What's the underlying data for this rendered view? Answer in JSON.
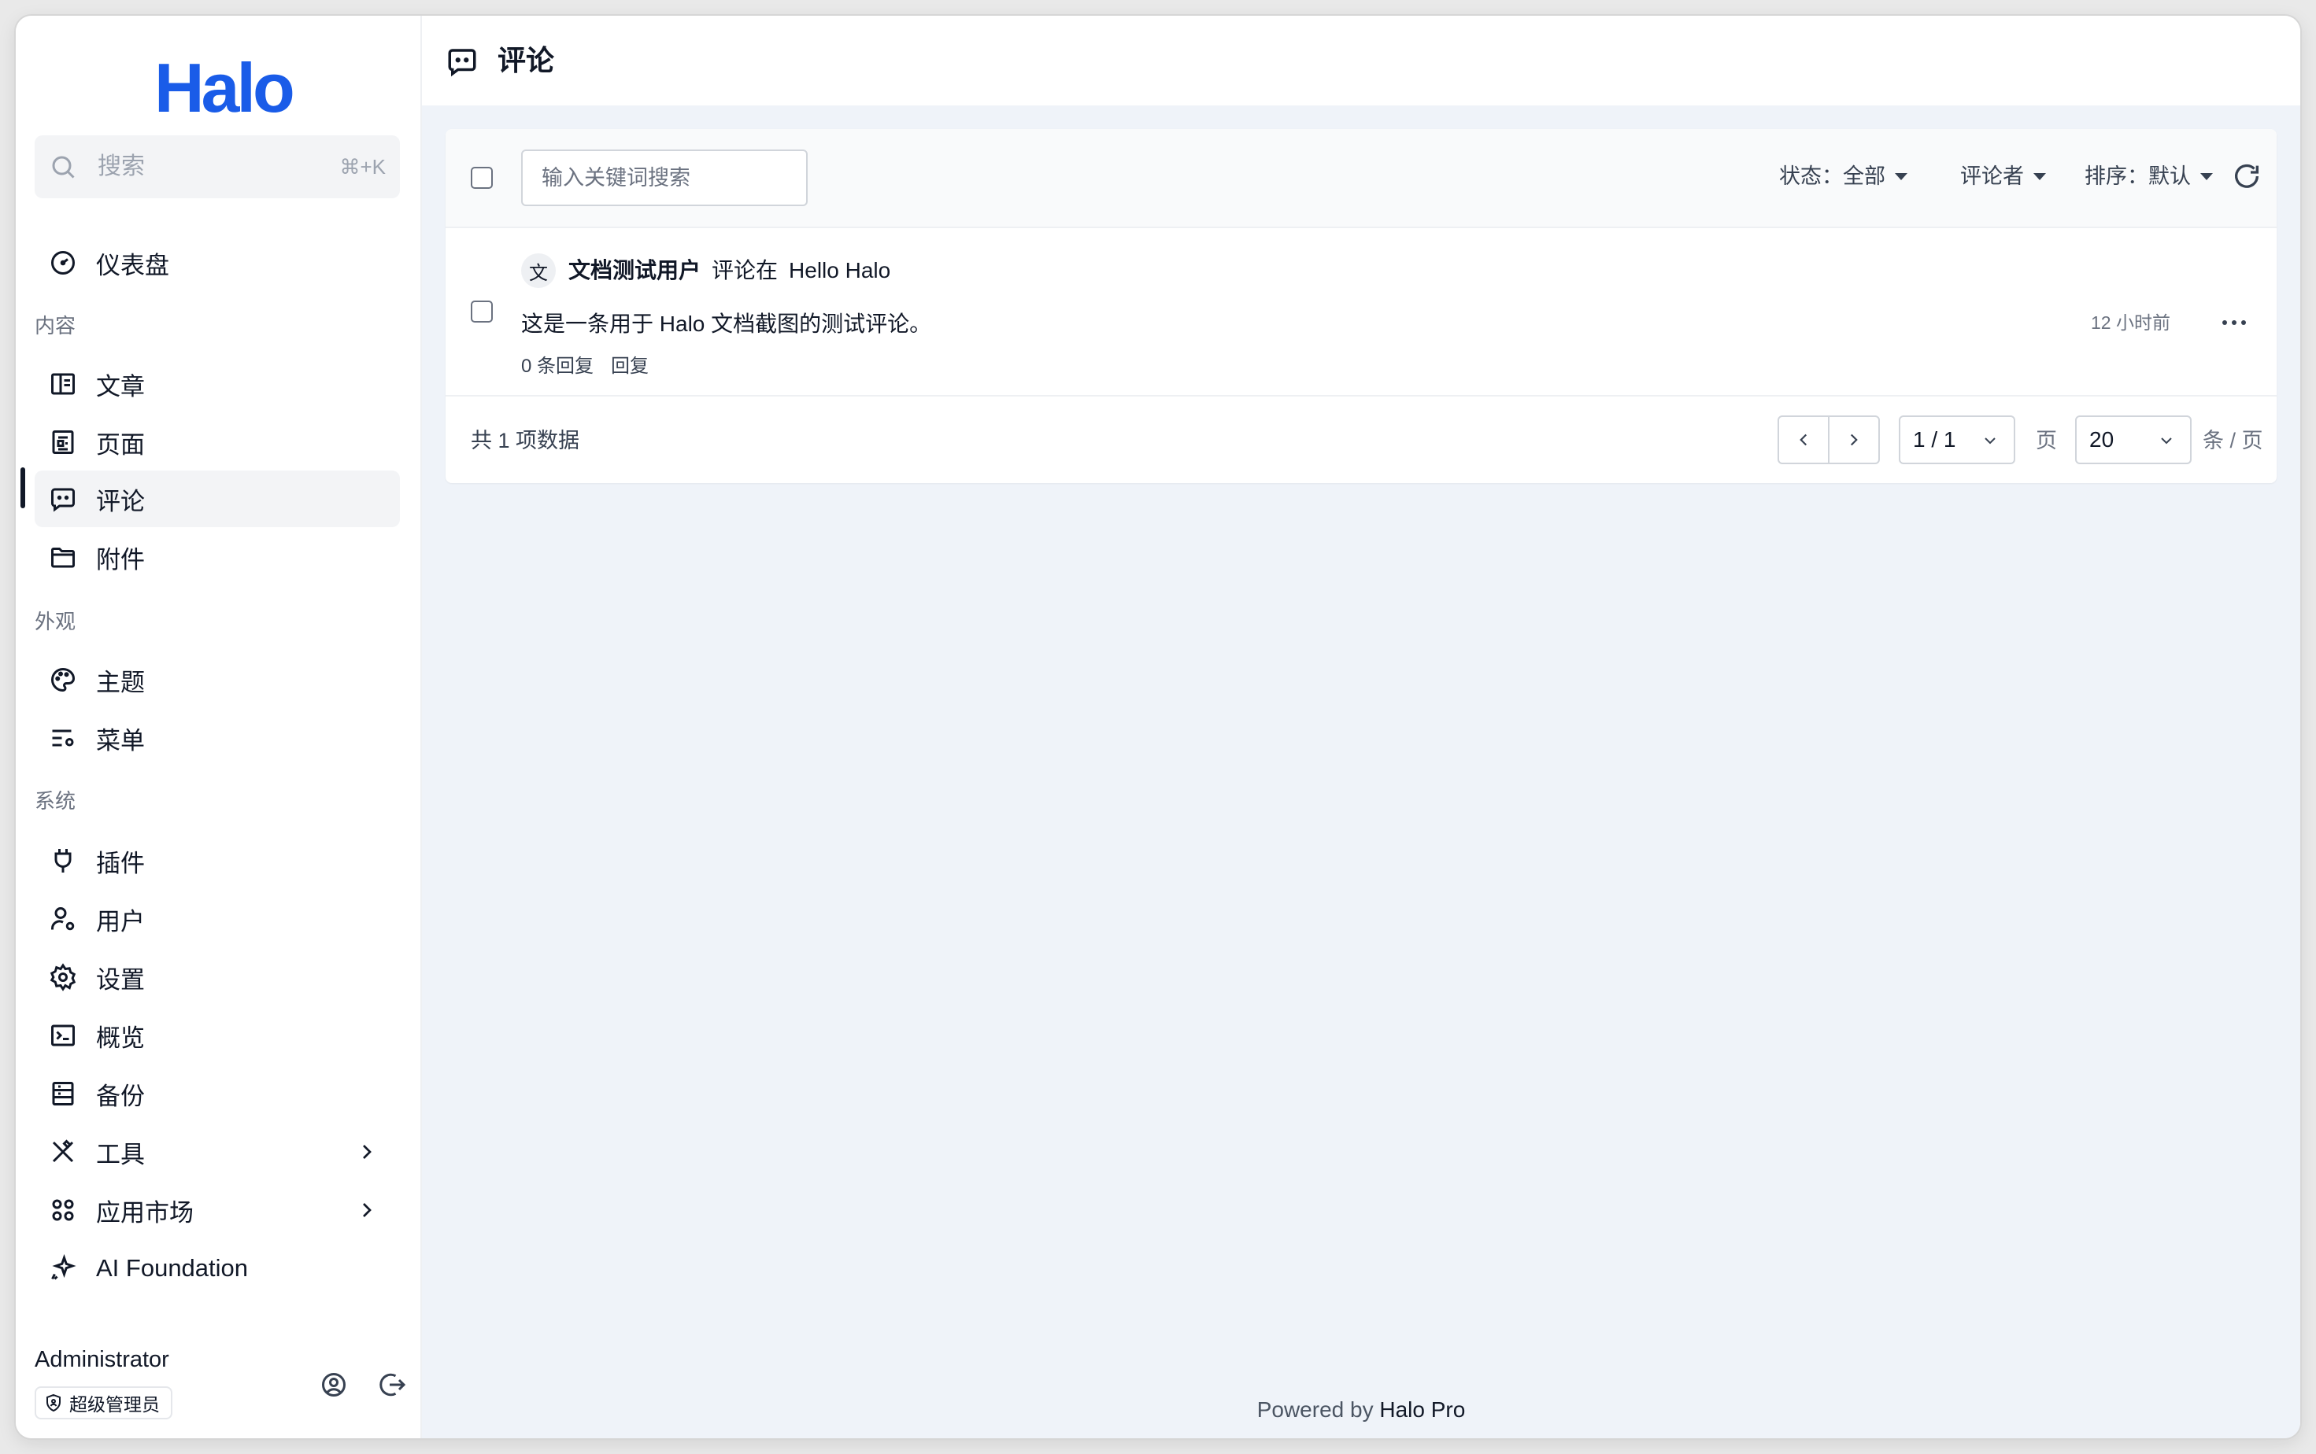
{
  "app": {
    "logo": "Halo"
  },
  "search": {
    "placeholder": "搜索",
    "shortcut": "⌘+K"
  },
  "sidebar": {
    "dashboard": "仪表盘",
    "sections": {
      "content": "内容",
      "appearance": "外观",
      "system": "系统"
    },
    "content_items": [
      "文章",
      "页面",
      "评论",
      "附件"
    ],
    "appearance_items": [
      "主题",
      "菜单"
    ],
    "system_items": [
      "插件",
      "用户",
      "设置",
      "概览",
      "备份",
      "工具",
      "应用市场",
      "AI Foundation"
    ],
    "active": "评论"
  },
  "user": {
    "name": "Administrator",
    "role": "超级管理员"
  },
  "page": {
    "title": "评论"
  },
  "toolbar": {
    "keyword_placeholder": "输入关键词搜索",
    "filters": {
      "status": "状态：全部",
      "commenter": "评论者",
      "sort": "排序：默认"
    }
  },
  "comments": [
    {
      "avatar_text": "文",
      "author": "文档测试用户",
      "action": "评论在",
      "post": "Hello Halo",
      "content": "这是一条用于 Halo 文档截图的测试评论。",
      "replies": "0 条回复",
      "reply_action": "回复",
      "time": "12 小时前"
    }
  ],
  "pagination": {
    "total": "共 1 项数据",
    "page": "1 / 1",
    "page_unit": "页",
    "page_size": "20",
    "size_unit": "条 / 页"
  },
  "footer": {
    "prefix": "Powered by",
    "brand": "Halo Pro"
  },
  "colors": {
    "brand": "#1a5ce8",
    "main_bg": "#eff3f9",
    "active_bar": "#111827"
  }
}
